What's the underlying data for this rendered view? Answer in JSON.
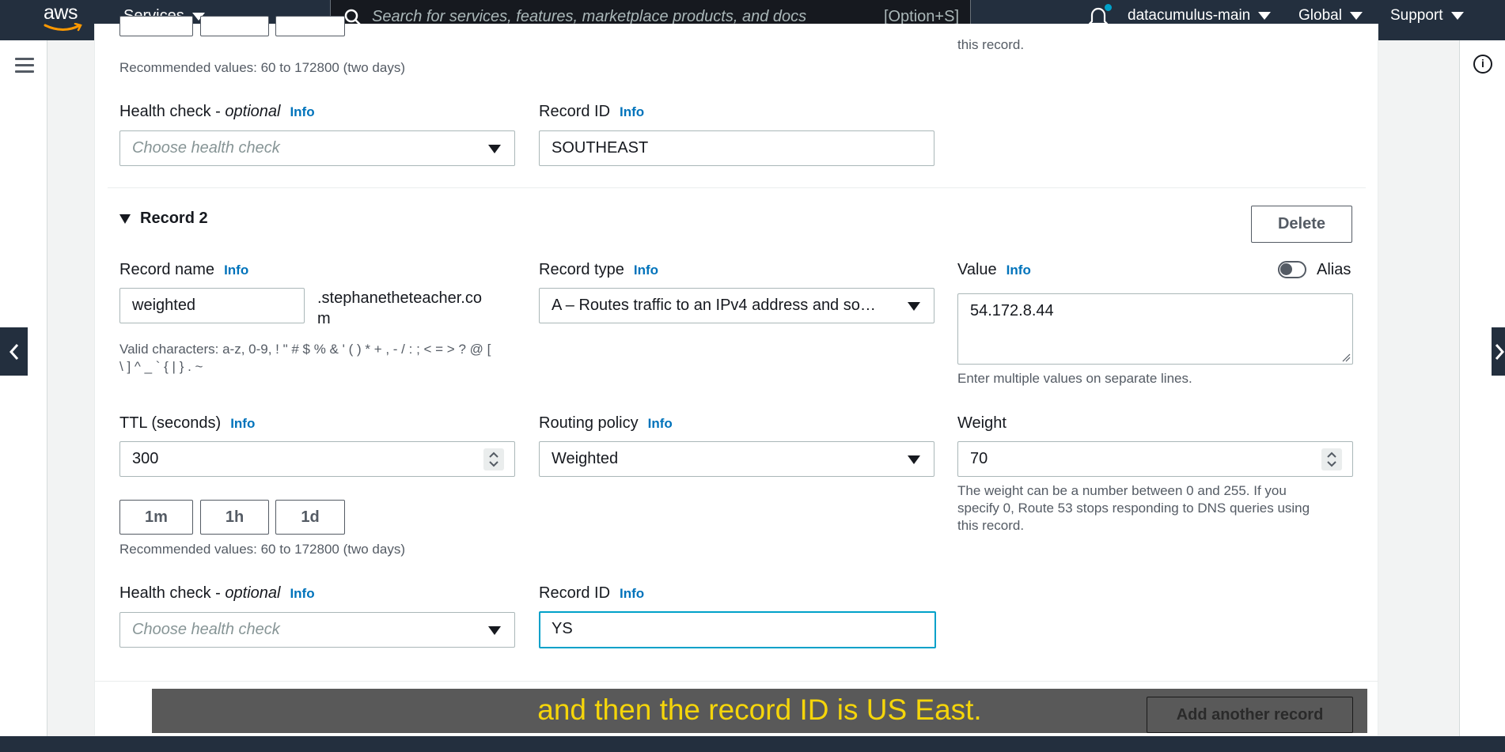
{
  "topnav": {
    "logo": "aws",
    "services": "Services",
    "search_placeholder": "Search for services, features, marketplace products, and docs",
    "search_shortcut": "[Option+S]",
    "account": "datacumulus-main",
    "region": "Global",
    "support": "Support",
    "notification_dot_color": "#00a1c9"
  },
  "record1": {
    "recommended": "Recommended values: 60 to 172800 (two days)",
    "weight_helper_tail": "this record.",
    "health_label": "Health check - ",
    "health_optional": "optional",
    "health_info": "Info",
    "health_placeholder": "Choose health check",
    "record_id_label": "Record ID",
    "record_id_info": "Info",
    "record_id_value": "SOUTHEAST"
  },
  "record2": {
    "title": "Record 2",
    "delete": "Delete",
    "name_label": "Record name",
    "name_info": "Info",
    "name_value": "weighted",
    "domain_suffix_1": ".stephanetheteacher.co",
    "domain_suffix_2": "m",
    "valid_chars_1": "Valid characters: a-z, 0-9, ! \" # $ % & ' ( ) * + , - / : ; < = > ? @ [",
    "valid_chars_2": "\\ ] ^ _ ` { | } . ~",
    "type_label": "Record type",
    "type_info": "Info",
    "type_value": "A – Routes traffic to an IPv4 address and so…",
    "value_label": "Value",
    "value_info": "Info",
    "alias_label": "Alias",
    "value_text": "54.172.8.44",
    "value_helper": "Enter multiple values on separate lines.",
    "ttl_label": "TTL (seconds)",
    "ttl_info": "Info",
    "ttl_value": "300",
    "ttl_buttons": [
      "1m",
      "1h",
      "1d"
    ],
    "recommended": "Recommended values: 60 to 172800 (two days)",
    "routing_label": "Routing policy",
    "routing_info": "Info",
    "routing_value": "Weighted",
    "weight_label": "Weight",
    "weight_value": "70",
    "weight_helper_1": "The weight can be a number between 0 and 255. If you",
    "weight_helper_2": "specify 0, Route 53 stops responding to DNS queries using",
    "weight_helper_3": "this record.",
    "health_label": "Health check - ",
    "health_optional": "optional",
    "health_info": "Info",
    "health_placeholder": "Choose health check",
    "record_id_label": "Record ID",
    "record_id_info": "Info",
    "record_id_value": "YS"
  },
  "footer": {
    "add_record": "Add another record",
    "caption": "and then the record ID is US East."
  },
  "colors": {
    "nav_bg": "#232f3e",
    "info_link": "#0073bb",
    "focus_border": "#00a1c9",
    "caption_text": "#f5d50a"
  }
}
